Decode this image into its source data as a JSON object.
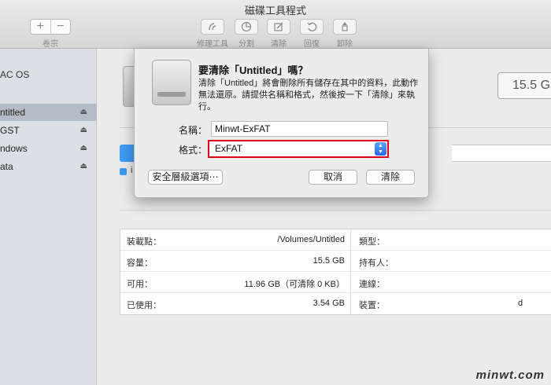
{
  "window": {
    "title": "磁碟工具程式"
  },
  "toolbar": {
    "volume_label": "卷宗",
    "add_symbol": "+",
    "remove_symbol": "−",
    "tools": [
      {
        "label": "修理工具",
        "icon": "first-aid-icon"
      },
      {
        "label": "分割",
        "icon": "partition-icon"
      },
      {
        "label": "清除",
        "icon": "erase-icon"
      },
      {
        "label": "回復",
        "icon": "restore-icon"
      },
      {
        "label": "卸除",
        "icon": "unmount-icon"
      }
    ]
  },
  "sidebar": {
    "header": "AC OS",
    "items": [
      {
        "label": "ntitled",
        "selected": true
      },
      {
        "label": "GST",
        "selected": false
      },
      {
        "label": "ndows",
        "selected": false
      },
      {
        "label": "ata",
        "selected": false
      }
    ],
    "eject_symbol": "⏏"
  },
  "main": {
    "capacity": "15.5 G",
    "legend_initial": "i",
    "info": {
      "rows": [
        {
          "lk": "裝載點：",
          "lv": "/Volumes/Untitled",
          "rk": "類型：",
          "rv": ""
        },
        {
          "lk": "容量：",
          "lv": "15.5 GB",
          "rk": "持有人：",
          "rv": ""
        },
        {
          "lk": "可用：",
          "lv": "11.96 GB（可清除 0 KB）",
          "rk": "連線：",
          "rv": ""
        },
        {
          "lk": "已使用：",
          "lv": "3.54 GB",
          "rk": "裝置：",
          "rv": "d"
        }
      ]
    }
  },
  "dialog": {
    "title": "要清除「Untitled」嗎？",
    "message": "清除「Untitled」將會刪除所有儲存在其中的資料，此動作無法還原。請提供名稱和格式，然後按一下「清除」來執行。",
    "name_label": "名稱：",
    "name_value": "Minwt-ExFAT",
    "format_label": "格式：",
    "format_value": "ExFAT",
    "security_button": "安全層級選項⋯",
    "cancel_button": "取消",
    "erase_button": "清除"
  },
  "watermark": "minwt.com",
  "colors": {
    "highlight": "#e0001a",
    "accent_blue": "#3e9bf6"
  }
}
